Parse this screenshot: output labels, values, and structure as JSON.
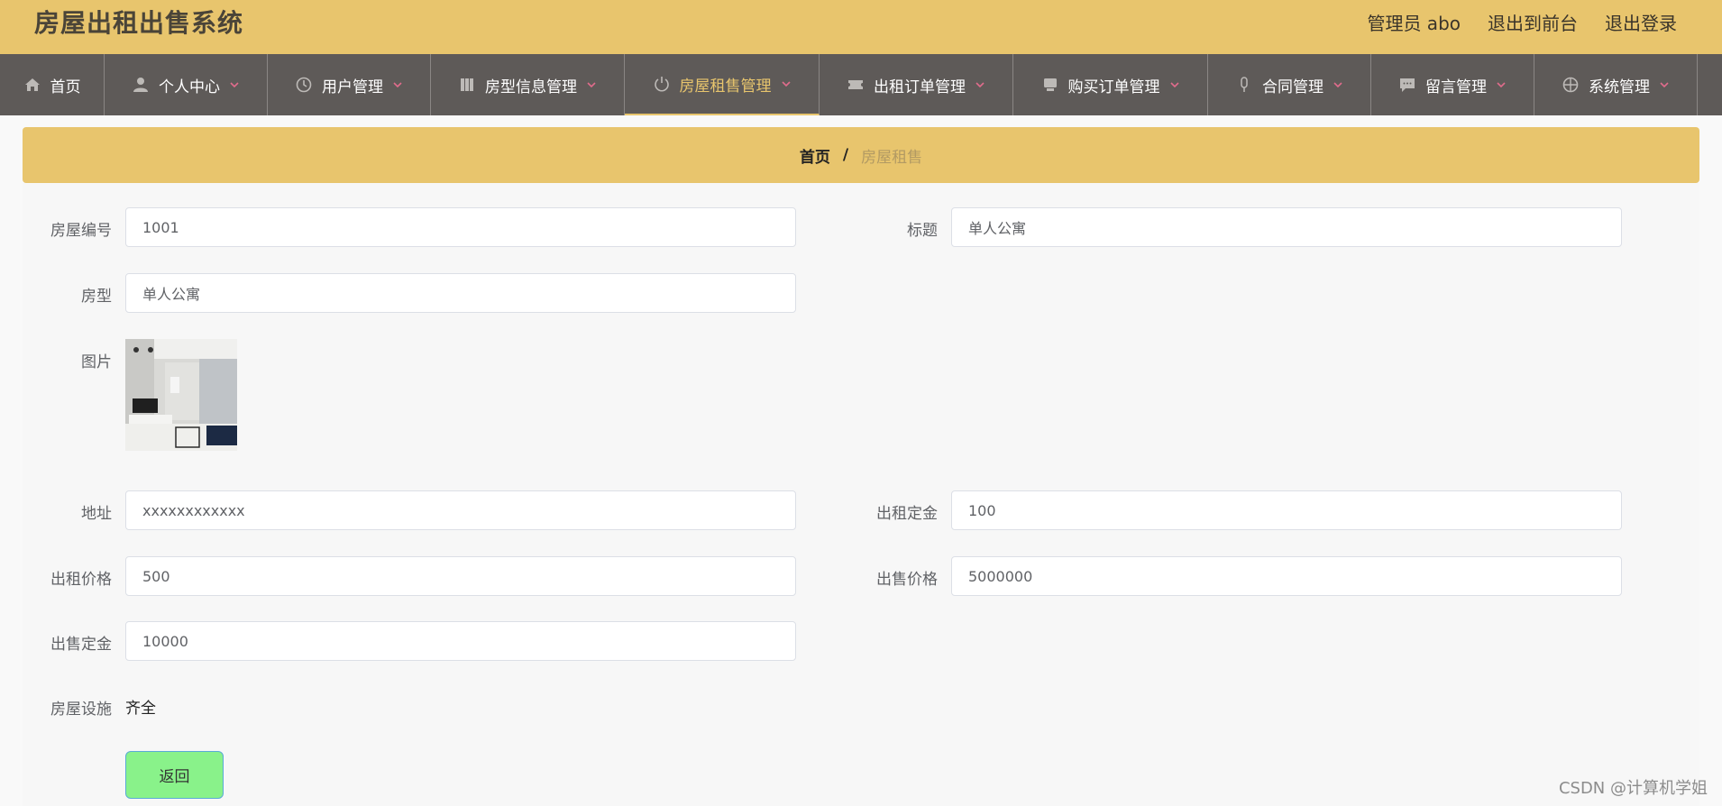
{
  "header": {
    "title": "房屋出租出售系统",
    "admin_label": "管理员 abo",
    "to_frontend": "退出到前台",
    "logout": "退出登录"
  },
  "nav": {
    "items": [
      {
        "label": "首页",
        "icon": "home-icon",
        "has_dropdown": false
      },
      {
        "label": "个人中心",
        "icon": "user-icon",
        "has_dropdown": true
      },
      {
        "label": "用户管理",
        "icon": "clock-icon",
        "has_dropdown": true
      },
      {
        "label": "房型信息管理",
        "icon": "book-icon",
        "has_dropdown": true
      },
      {
        "label": "房屋租售管理",
        "icon": "power-icon",
        "has_dropdown": true,
        "active": true
      },
      {
        "label": "出租订单管理",
        "icon": "ticket-icon",
        "has_dropdown": true
      },
      {
        "label": "购买订单管理",
        "icon": "monitor-icon",
        "has_dropdown": true
      },
      {
        "label": "合同管理",
        "icon": "microphone-icon",
        "has_dropdown": true
      },
      {
        "label": "留言管理",
        "icon": "message-icon",
        "has_dropdown": true
      },
      {
        "label": "系统管理",
        "icon": "crosshair-icon",
        "has_dropdown": true
      }
    ]
  },
  "breadcrumb": {
    "home": "首页",
    "separator": "/",
    "current": "房屋租售"
  },
  "form": {
    "house_no": {
      "label": "房屋编号",
      "value": "1001"
    },
    "title": {
      "label": "标题",
      "value": "单人公寓"
    },
    "house_type": {
      "label": "房型",
      "value": "单人公寓"
    },
    "picture": {
      "label": "图片"
    },
    "address": {
      "label": "地址",
      "value": "xxxxxxxxxxxx"
    },
    "rent_deposit": {
      "label": "出租定金",
      "value": "100"
    },
    "rent_price": {
      "label": "出租价格",
      "value": "500"
    },
    "sale_price": {
      "label": "出售价格",
      "value": "5000000"
    },
    "sale_deposit": {
      "label": "出售定金",
      "value": "10000"
    },
    "facilities": {
      "label": "房屋设施",
      "value": "齐全"
    },
    "back_button": "返回"
  },
  "watermark": "CSDN @计算机学姐",
  "colors": {
    "accent": "#e8c56d",
    "nav_bg": "#5e5a58",
    "button_bg": "#89f28a"
  }
}
